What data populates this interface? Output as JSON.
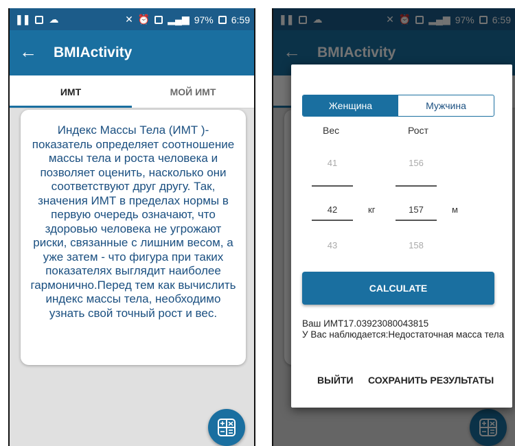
{
  "status": {
    "battery": "97%",
    "time": "6:59"
  },
  "appbar": {
    "back_glyph": "←",
    "title": "BMIActivity"
  },
  "tabs": [
    {
      "label": "ИМТ",
      "active": true
    },
    {
      "label": "МОЙ ИМТ",
      "active": false
    }
  ],
  "info": {
    "text": "Индекс Массы Тела (ИМТ )-показатель определяет соотношение массы тела и роста человека и позволяет оценить, насколько они соответствуют друг другу. Так, значения ИМТ в пределах нормы в первую очередь означают, что здоровью человека не угрожают риски, связанные с лишним весом, а уже затем - что фигура при таких показателях выглядит наиболее гармонично.Перед тем как вычислить индекс массы тела, необходимо узнать свой точный рост и вес."
  },
  "fab": {
    "icon": "calculator-icon"
  },
  "dialog": {
    "gender_options": [
      "Женщина",
      "Мужчина"
    ],
    "selected_gender": "Женщина",
    "weight_label": "Вес",
    "height_label": "Рост",
    "weight_picker": {
      "prev": "41",
      "current": "42",
      "next": "43",
      "unit": "кг"
    },
    "height_picker": {
      "prev": "156",
      "current": "157",
      "next": "158",
      "unit": "м"
    },
    "calculate_label": "CALCULATE",
    "result_value": "Ваш ИМТ17.03923080043815",
    "result_status": "У Вас наблюдается:Недостаточная масса тела",
    "exit_label": "ВЫЙТИ",
    "save_label": "СОХРАНИТЬ РЕЗУЛЬТАТЫ"
  },
  "colors": {
    "status_bar": "#1c5c8a",
    "app_bar": "#1a6fa0",
    "text_blue": "#1a4f80",
    "background": "#e0e0e0"
  }
}
